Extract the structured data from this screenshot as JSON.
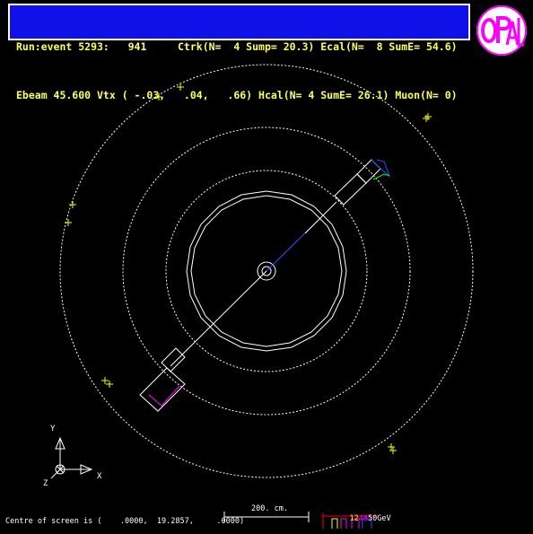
{
  "header": {
    "line1": "Run:event 5293:   941     Ctrk(N=  4 Sump= 20.3) Ecal(N=  8 SumE= 54.6)",
    "line2": "Ebeam 45.600 Vtx ( -.03,   .04,   .66) Hcal(N= 4 SumE= 26.1) Muon(N= 0)"
  },
  "logo_text": "OPAL",
  "axes": {
    "y_label": "Y",
    "x_label": "X",
    "z_label": "Z"
  },
  "scale_bar_label": "200. cm.",
  "energy_scale": {
    "values": [
      "12",
      "4",
      "8",
      "50",
      "GeV"
    ],
    "colors": [
      "#ffff00",
      "#ff00ff",
      "#ff00ff",
      "#ffffff",
      "#ffffff"
    ]
  },
  "footer": "Centre of screen is (    .0000,  19.2857,     .0000)",
  "colors": {
    "background": "#000000",
    "header_bg": "#1010e8",
    "header_text": "#ffff60",
    "detector": "#ffffff",
    "track": "#3050ff",
    "hits": "#ffff00",
    "ecal": "#ff00ff",
    "hcal": "#00ff00"
  }
}
